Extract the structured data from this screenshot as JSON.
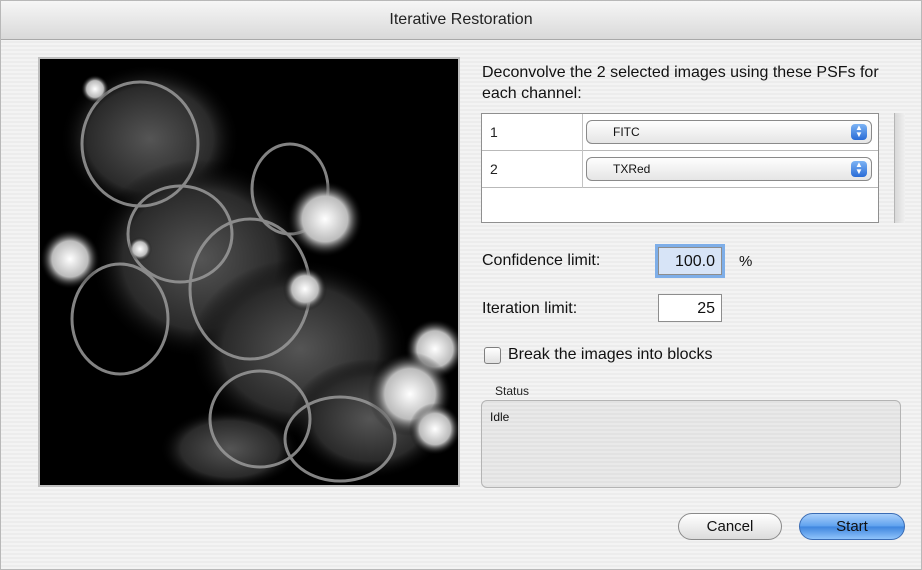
{
  "window": {
    "title": "Iterative Restoration"
  },
  "preview": {
    "icon": "fluorescence-micrograph-image"
  },
  "instructions": "Deconvolve the 2 selected images using these PSFs for each channel:",
  "psf_rows": [
    {
      "index": "1",
      "psf": "FITC"
    },
    {
      "index": "2",
      "psf": "TXRed"
    }
  ],
  "confidence": {
    "label": "Confidence limit:",
    "value": "100.0",
    "unit": "%"
  },
  "iteration": {
    "label": "Iteration limit:",
    "value": "25"
  },
  "blocks": {
    "label": "Break the images into blocks",
    "checked": false
  },
  "status": {
    "title": "Status",
    "text": "Idle"
  },
  "buttons": {
    "cancel": "Cancel",
    "start": "Start"
  },
  "colors": {
    "default_button": "#5da0ee",
    "focus_ring": "#7eaee8",
    "popup_arrows": "#2a6cd6"
  }
}
